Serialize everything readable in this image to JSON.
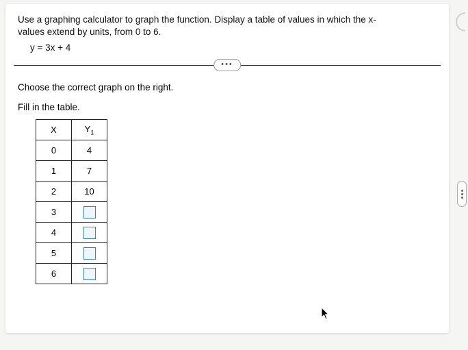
{
  "instruction": "Use a graphing calculator to graph the function. Display a table of values in which the x-values extend by units, from 0 to 6.",
  "equation": "y = 3x + 4",
  "divider_label": "•••",
  "prompt_graph": "Choose the correct graph on the right.",
  "prompt_fill": "Fill in the table.",
  "table": {
    "headers": {
      "x": "X",
      "y": "Y",
      "ysub": "1"
    },
    "rows": [
      {
        "x": "0",
        "y": "4",
        "filled": true
      },
      {
        "x": "1",
        "y": "7",
        "filled": true
      },
      {
        "x": "2",
        "y": "10",
        "filled": true
      },
      {
        "x": "3",
        "y": "",
        "filled": false
      },
      {
        "x": "4",
        "y": "",
        "filled": false
      },
      {
        "x": "5",
        "y": "",
        "filled": false
      },
      {
        "x": "6",
        "y": "",
        "filled": false
      }
    ]
  }
}
